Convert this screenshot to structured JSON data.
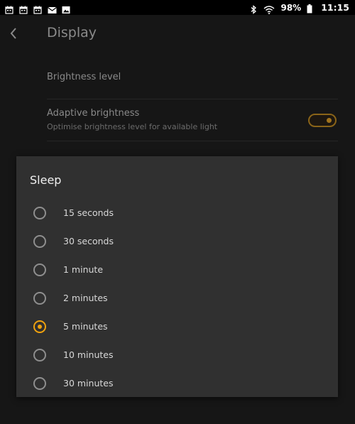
{
  "status_bar": {
    "icons_left": [
      "calendar-icon",
      "calendar-icon",
      "calendar-icon",
      "mail-icon",
      "image-icon"
    ],
    "icons_right": [
      "bluetooth-icon",
      "wifi-icon",
      "battery-icon"
    ],
    "battery": "98%",
    "time": "11:15"
  },
  "header": {
    "back_icon": "chevron-left-icon",
    "title": "Display"
  },
  "settings": {
    "brightness": {
      "title": "Brightness level"
    },
    "adaptive": {
      "title": "Adaptive brightness",
      "subtitle": "Optimise brightness level for available light",
      "enabled": true
    }
  },
  "dialog": {
    "title": "Sleep",
    "selected_index": 4,
    "options": [
      {
        "label": "15 seconds"
      },
      {
        "label": "30 seconds"
      },
      {
        "label": "1 minute"
      },
      {
        "label": "2 minutes"
      },
      {
        "label": "5 minutes"
      },
      {
        "label": "10 minutes"
      },
      {
        "label": "30 minutes"
      }
    ]
  },
  "colors": {
    "accent": "#f0a20e",
    "dialog_bg": "#303030",
    "screen_bg": "#161616"
  }
}
